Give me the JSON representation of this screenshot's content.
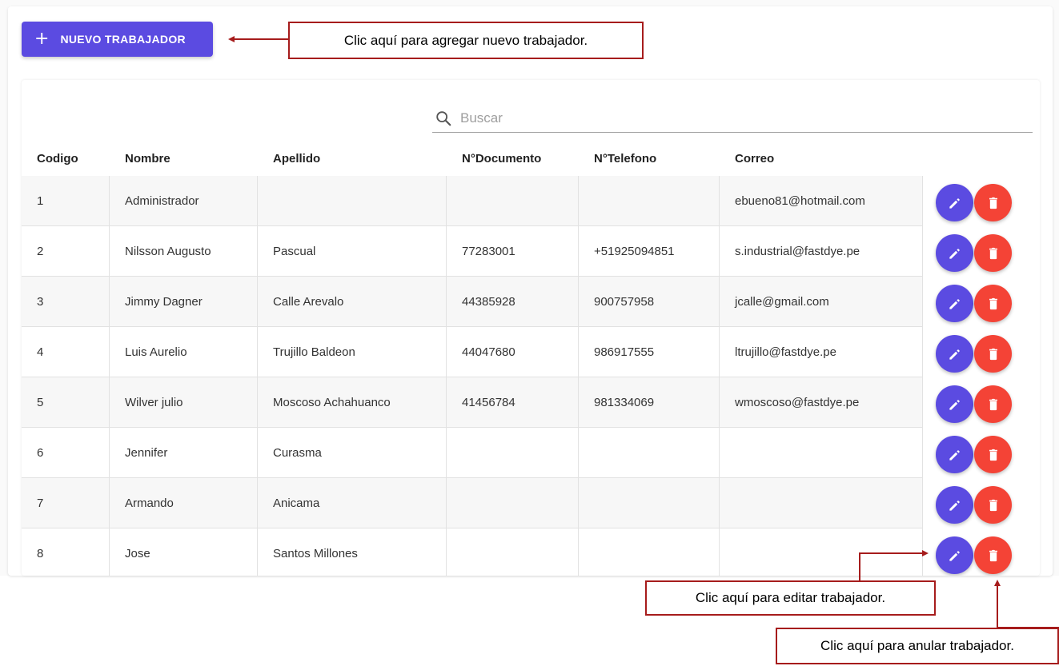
{
  "toolbar": {
    "new_label": "NUEVO TRABAJADOR"
  },
  "search": {
    "placeholder": "Buscar"
  },
  "columns": [
    "Codigo",
    "Nombre",
    "Apellido",
    "N°Documento",
    "N°Telefono",
    "Correo"
  ],
  "rows": [
    [
      "1",
      "Administrador",
      "",
      "",
      "",
      "ebueno81@hotmail.com"
    ],
    [
      "2",
      "Nilsson Augusto",
      "Pascual",
      "77283001",
      "+51925094851",
      "s.industrial@fastdye.pe"
    ],
    [
      "3",
      "Jimmy Dagner",
      "Calle Arevalo",
      "44385928",
      "900757958",
      "jcalle@gmail.com"
    ],
    [
      "4",
      "Luis Aurelio",
      "Trujillo Baldeon",
      "44047680",
      "986917555",
      "ltrujillo@fastdye.pe"
    ],
    [
      "5",
      "Wilver julio",
      "Moscoso Achahuanco",
      "41456784",
      "981334069",
      "wmoscoso@fastdye.pe"
    ],
    [
      "6",
      "Jennifer",
      "Curasma",
      "",
      "",
      ""
    ],
    [
      "7",
      "Armando",
      "Anicama",
      "",
      "",
      ""
    ],
    [
      "8",
      "Jose",
      "Santos Millones",
      "",
      "",
      ""
    ]
  ],
  "callouts": {
    "add": "Clic aquí para agregar nuevo trabajador.",
    "edit": "Clic aquí para editar trabajador.",
    "delete": "Clic aquí para anular trabajador."
  },
  "colors": {
    "primary": "#5b4be1",
    "danger": "#f44336",
    "callout_border": "#a61c1c"
  }
}
